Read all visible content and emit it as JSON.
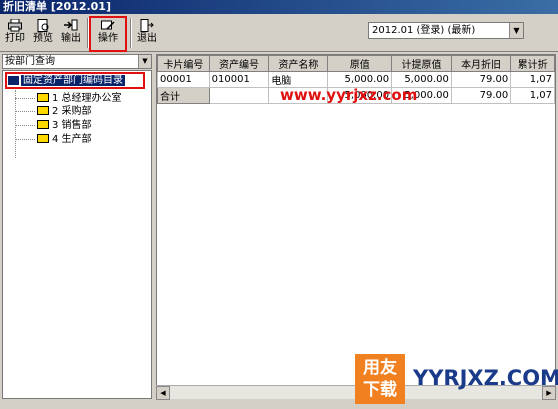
{
  "window": {
    "title": "折旧清单 [2012.01]"
  },
  "toolbar": {
    "print": "打印",
    "preview": "预览",
    "export": "输出",
    "operate": "操作",
    "exit": "退出"
  },
  "period": {
    "selected": "2012.01 (登录) (最新)"
  },
  "left": {
    "query_mode": "按部门查询",
    "tree_root": "固定资产部门编码目录",
    "departments": [
      "1 总经理办公室",
      "2 采购部",
      "3 销售部",
      "4 生产部"
    ]
  },
  "grid": {
    "columns": [
      "卡片编号",
      "资产编号",
      "资产名称",
      "原值",
      "计提原值",
      "本月折旧",
      "累计折"
    ],
    "rows": [
      [
        "00001",
        "010001",
        "电脑",
        "5,000.00",
        "5,000.00",
        "79.00",
        "1,07"
      ],
      [
        "合计",
        "",
        "",
        "5,000.00",
        "5,000.00",
        "79.00",
        "1,07"
      ]
    ]
  },
  "watermark": {
    "site": "www.yyrjxz.com",
    "logo_cn": "用友下载",
    "logo_en": "YYRJXZ.COM"
  }
}
